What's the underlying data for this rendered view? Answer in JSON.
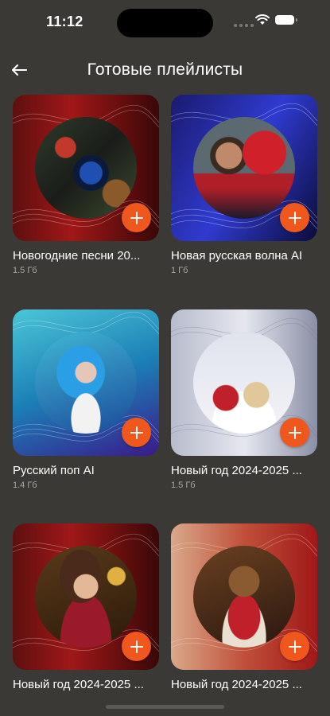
{
  "status": {
    "time": "11:12"
  },
  "header": {
    "title": "Готовые плейлисты"
  },
  "playlists": [
    {
      "name": "Новогодние песни 20...",
      "size": "1.5 Гб"
    },
    {
      "name": "Новая русская волна AI",
      "size": "1 Гб"
    },
    {
      "name": "Русский поп AI",
      "size": "1.4 Гб"
    },
    {
      "name": "Новый год 2024-2025 ...",
      "size": "1.5 Гб"
    },
    {
      "name": "Новый год 2024-2025 ...",
      "size": ""
    },
    {
      "name": "Новый год 2024-2025 ...",
      "size": ""
    }
  ],
  "colors": {
    "accent": "#f0571c",
    "background": "#3a3936"
  },
  "icons": {
    "back": "arrow-left-icon",
    "add": "plus-icon"
  }
}
